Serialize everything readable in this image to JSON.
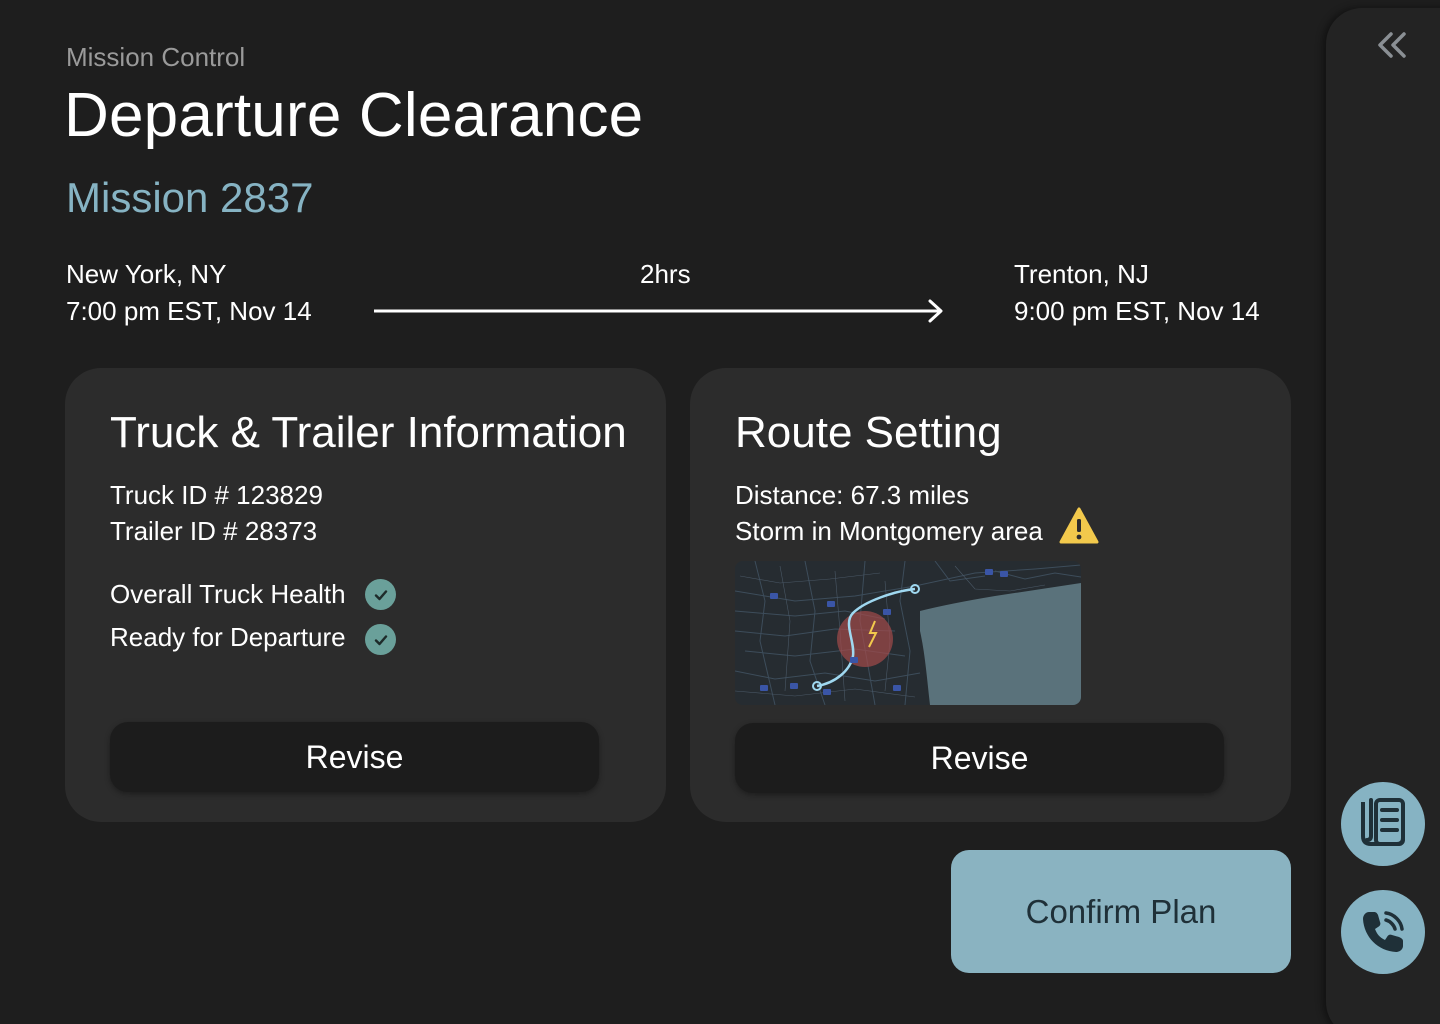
{
  "header": {
    "breadcrumb": "Mission Control",
    "title": "Departure Clearance",
    "mission": "Mission 2837"
  },
  "route": {
    "origin_city": "New York, NY",
    "origin_time": "7:00 pm EST, Nov 14",
    "duration": "2hrs",
    "dest_city": "Trenton, NJ",
    "dest_time": "9:00 pm EST, Nov 14"
  },
  "truck_card": {
    "title": "Truck & Trailer Information",
    "truck_id": "Truck ID # 123829",
    "trailer_id": "Trailer ID # 28373",
    "health_label": "Overall Truck Health",
    "ready_label": "Ready for Departure",
    "revise_label": "Revise"
  },
  "route_card": {
    "title": "Route Setting",
    "distance": "Distance: 67.3 miles",
    "storm_warning": "Storm in Montgomery area",
    "revise_label": "Revise"
  },
  "confirm_label": "Confirm Plan",
  "sidebar": {
    "collapse_icon": "double-chevron-left-icon",
    "buttons": [
      "document-list-icon",
      "phone-icon"
    ]
  },
  "colors": {
    "background": "#1e1e1e",
    "card": "#2c2c2c",
    "accent": "#86b3c3",
    "check": "#6aa09a",
    "warning": "#f2c94c"
  }
}
